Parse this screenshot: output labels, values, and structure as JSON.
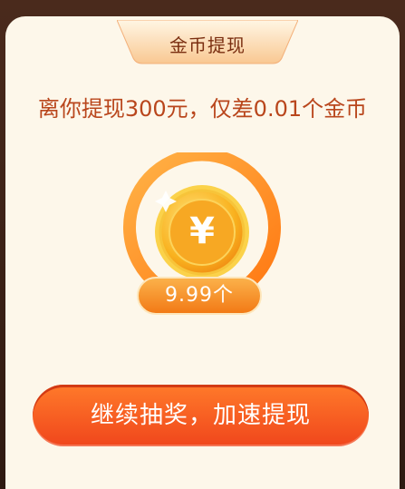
{
  "dialog": {
    "title": "金币提现",
    "message": "离你提现300元，仅差0.01个金币",
    "coin_symbol": "¥",
    "coin_balance": "9.99个",
    "cta_label": "继续抽奖，加速提现",
    "progress": 0.999
  },
  "colors": {
    "card_background": "#fdf7ea",
    "message_text": "#b9461c",
    "button": "#f05a1f",
    "coin_gold": "#f7a823"
  }
}
